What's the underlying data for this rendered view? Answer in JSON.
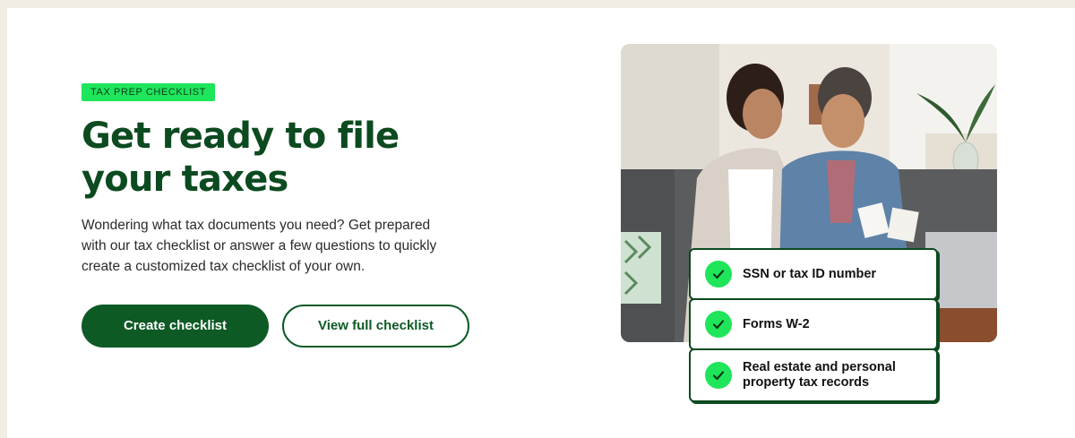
{
  "hero": {
    "badge": "TAX PREP CHECKLIST",
    "headline": "Get ready to file your taxes",
    "subtext": "Wondering what tax documents you need? Get prepared with our tax checklist or answer a few questions to quickly create a customized tax checklist of your own.",
    "primary_button": "Create checklist",
    "secondary_button": "View full checklist"
  },
  "checklist": {
    "items": [
      {
        "label": "SSN or tax ID number"
      },
      {
        "label": "Forms W-2"
      },
      {
        "label": "Real estate and personal property tax records"
      }
    ]
  },
  "colors": {
    "brand_green": "#0d5a25",
    "accent_green": "#1fe55a",
    "page_bg": "#f1ede3"
  },
  "icons": {
    "check": "checkmark-icon"
  }
}
